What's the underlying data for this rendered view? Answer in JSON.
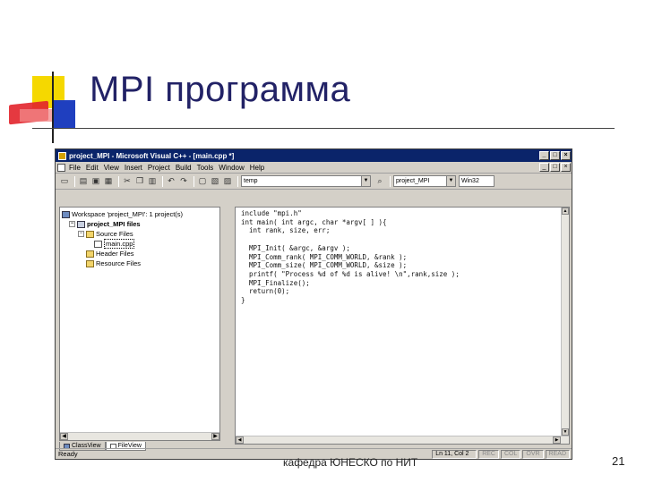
{
  "slide": {
    "title": "MPI программа",
    "footer": "кафедра ЮНЕСКО по НИТ",
    "page_number": "21"
  },
  "window": {
    "title": "project_MPI - Microsoft Visual C++ - [main.cpp *]",
    "controls": [
      "_",
      "□",
      "×"
    ],
    "menu": [
      "File",
      "Edit",
      "View",
      "Insert",
      "Project",
      "Build",
      "Tools",
      "Window",
      "Help"
    ],
    "doc_controls": [
      "_",
      "□",
      "×"
    ]
  },
  "toolbar": {
    "find_combo_value": "temp",
    "config_combo_value": "project_MPI",
    "platform_combo_value": "Win32"
  },
  "workspace": {
    "tree": [
      {
        "label": "Workspace 'project_MPI': 1 project(s)",
        "icon": "workspace-icon",
        "level": 0
      },
      {
        "label": "project_MPI files",
        "icon": "project-icon",
        "level": 1
      },
      {
        "label": "Source Files",
        "icon": "folder-icon",
        "level": 2
      },
      {
        "label": "main.cpp",
        "icon": "file-icon",
        "level": 3
      },
      {
        "label": "Header Files",
        "icon": "folder-icon",
        "level": 2
      },
      {
        "label": "Resource Files",
        "icon": "folder-icon",
        "level": 2
      }
    ],
    "tabs": [
      "ClassView",
      "FileView"
    ]
  },
  "editor": {
    "code_lines": [
      "include \"mpi.h\"",
      "int main( int argc, char *argv[ ] ){",
      "  int rank, size, err;",
      "",
      "  MPI_Init( &argc, &argv );",
      "  MPI_Comm_rank( MPI_COMM_WORLD, &rank );",
      "  MPI_Comm_size( MPI_COMM_WORLD, &size );",
      "  printf( \"Process %d of %d is alive! \\n\",rank,size );",
      "  MPI_Finalize();",
      "  return(0);",
      "}"
    ]
  },
  "status": {
    "ready": "Ready",
    "position": "Ln 11, Col 2",
    "indicators": [
      "REC",
      "COL",
      "OVR",
      "READ"
    ]
  }
}
